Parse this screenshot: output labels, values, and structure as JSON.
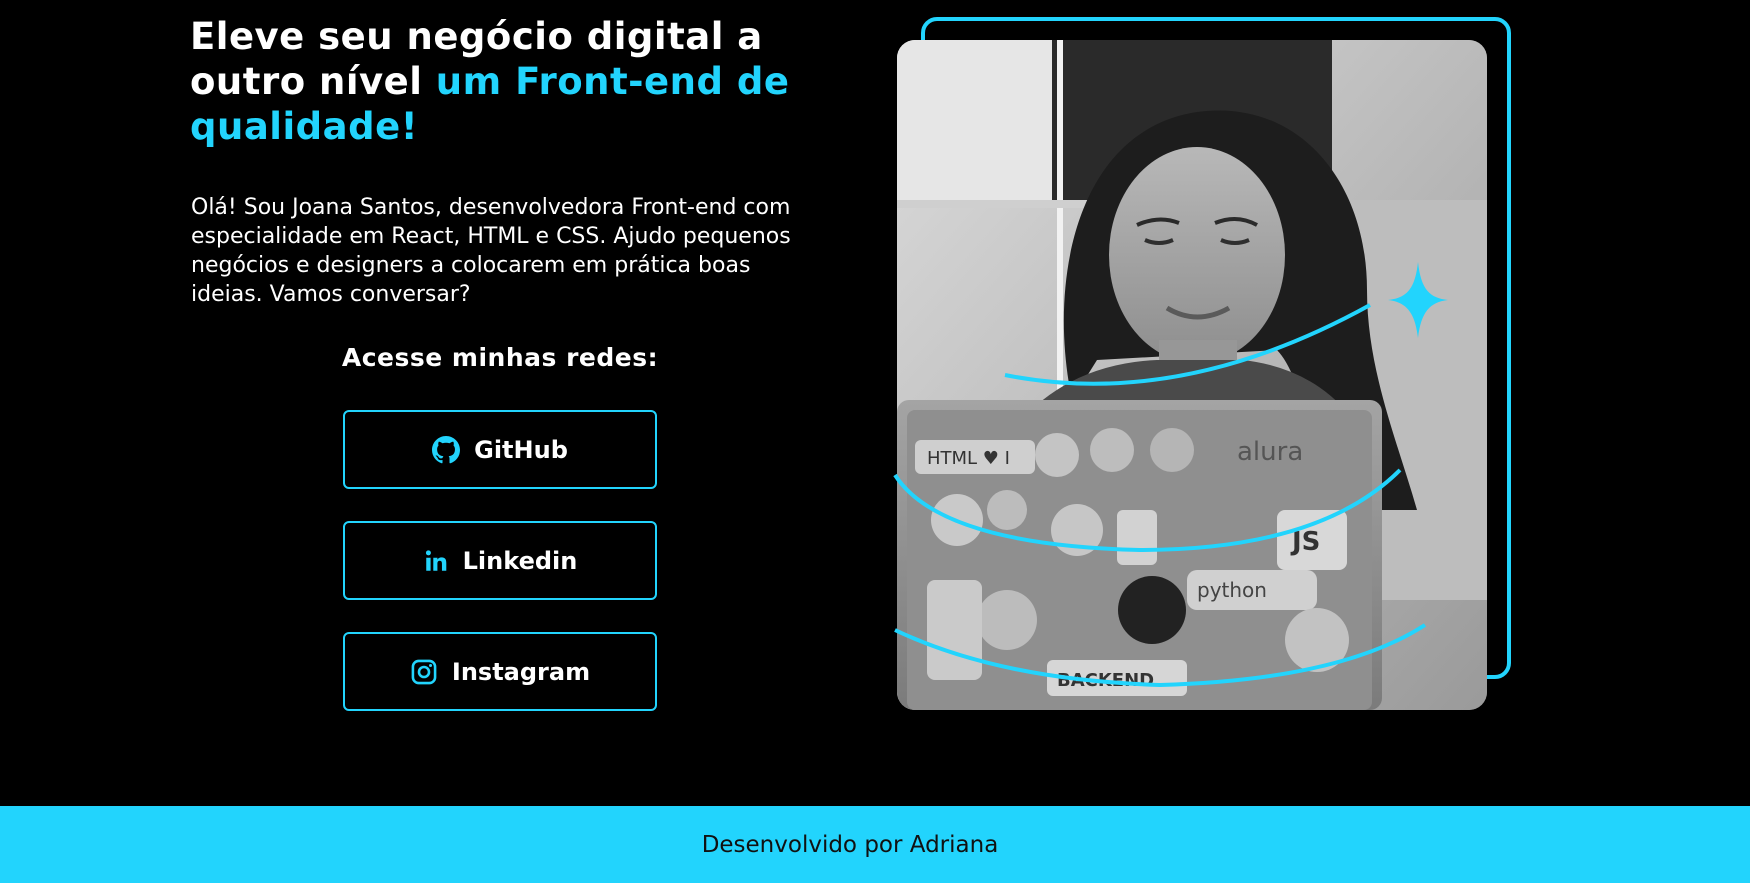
{
  "hero": {
    "headline_plain": "Eleve seu negócio digital a outro nível ",
    "headline_accent": "um Front-end de qualidade!",
    "intro": "Olá! Sou Joana Santos, desenvolvedora Front-end com especialidade em React, HTML e CSS. Ajudo pequenos negócios e designers a colocarem em prática boas ideias. Vamos conversar?"
  },
  "socials": {
    "title": "Acesse minhas redes:",
    "links": [
      {
        "label": "GitHub",
        "icon": "github-icon"
      },
      {
        "label": "Linkedin",
        "icon": "linkedin-icon"
      },
      {
        "label": "Instagram",
        "icon": "instagram-icon"
      }
    ]
  },
  "photo": {
    "alt": "Foto de Joana Santos",
    "stickers": [
      "HTML ♥ I",
      "alura",
      "JS",
      "python",
      "BACKEND"
    ]
  },
  "footer": {
    "text": "Desenvolvido por Adriana"
  },
  "colors": {
    "accent": "#22d4fd",
    "background": "#000000",
    "text": "#ffffff"
  }
}
